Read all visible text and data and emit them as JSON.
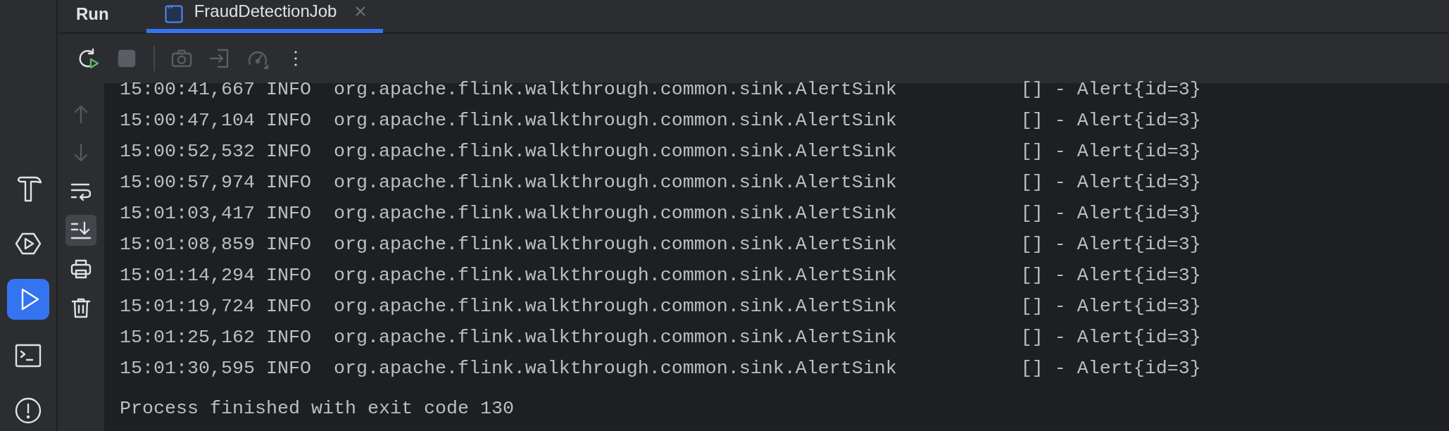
{
  "sidebar": {
    "items": [
      {
        "kind": "build",
        "selected": false
      },
      {
        "kind": "services",
        "selected": false
      },
      {
        "kind": "run",
        "selected": true
      },
      {
        "kind": "terminal",
        "selected": false
      },
      {
        "kind": "problems",
        "selected": false
      }
    ]
  },
  "panel": {
    "title": "Run",
    "tabs": [
      {
        "label": "FraudDetectionJob",
        "selected": true
      }
    ]
  },
  "toolbar": [
    {
      "kind": "rerun",
      "disabled": false
    },
    {
      "kind": "stop",
      "disabled": true
    },
    {
      "kind": "separator"
    },
    {
      "kind": "camera",
      "disabled": true
    },
    {
      "kind": "attach",
      "disabled": true
    },
    {
      "kind": "profiler",
      "disabled": true
    },
    {
      "kind": "more",
      "disabled": false
    }
  ],
  "console_tools": [
    {
      "kind": "up",
      "disabled": true,
      "selected": false
    },
    {
      "kind": "down",
      "disabled": true,
      "selected": false
    },
    {
      "kind": "wrap",
      "disabled": false,
      "selected": false
    },
    {
      "kind": "scroll-end",
      "disabled": false,
      "selected": true
    },
    {
      "kind": "print",
      "disabled": false,
      "selected": false
    },
    {
      "kind": "trash",
      "disabled": false,
      "selected": false
    }
  ],
  "console": {
    "lines": [
      "15:00:41,667 INFO  org.apache.flink.walkthrough.common.sink.AlertSink           [] - Alert{id=3}",
      "15:00:47,104 INFO  org.apache.flink.walkthrough.common.sink.AlertSink           [] - Alert{id=3}",
      "15:00:52,532 INFO  org.apache.flink.walkthrough.common.sink.AlertSink           [] - Alert{id=3}",
      "15:00:57,974 INFO  org.apache.flink.walkthrough.common.sink.AlertSink           [] - Alert{id=3}",
      "15:01:03,417 INFO  org.apache.flink.walkthrough.common.sink.AlertSink           [] - Alert{id=3}",
      "15:01:08,859 INFO  org.apache.flink.walkthrough.common.sink.AlertSink           [] - Alert{id=3}",
      "15:01:14,294 INFO  org.apache.flink.walkthrough.common.sink.AlertSink           [] - Alert{id=3}",
      "15:01:19,724 INFO  org.apache.flink.walkthrough.common.sink.AlertSink           [] - Alert{id=3}",
      "15:01:25,162 INFO  org.apache.flink.walkthrough.common.sink.AlertSink           [] - Alert{id=3}",
      "15:01:30,595 INFO  org.apache.flink.walkthrough.common.sink.AlertSink           [] - Alert{id=3}"
    ],
    "status_line": "Process finished with exit code 130"
  }
}
